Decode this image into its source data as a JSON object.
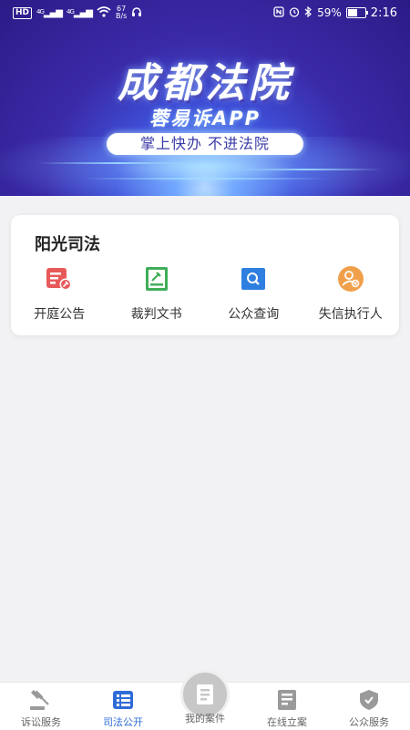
{
  "status_bar": {
    "network": "HD",
    "net_speed_value": "67",
    "net_speed_unit": "B/s",
    "signal_1": "4G",
    "signal_2": "4G",
    "battery_percent": "59%",
    "battery_level": 0.59,
    "time": "2:16"
  },
  "banner": {
    "title": "成都法院",
    "subtitle": "蓉易诉APP",
    "slogan": "掌上快办  不进法院"
  },
  "section": {
    "title": "阳光司法",
    "items": [
      {
        "label": "开庭公告",
        "icon": "court-notice-icon",
        "color": "#e8595a"
      },
      {
        "label": "裁判文书",
        "icon": "judgment-document-icon",
        "color": "#3fae5a"
      },
      {
        "label": "公众查询",
        "icon": "public-search-icon",
        "color": "#2f7fe0"
      },
      {
        "label": "失信执行人",
        "icon": "dishonest-executee-icon",
        "color": "#f0a04b"
      }
    ]
  },
  "tabbar": {
    "tabs": [
      {
        "label": "诉讼服务",
        "icon": "gavel-icon"
      },
      {
        "label": "司法公开",
        "icon": "list-icon"
      },
      {
        "label": "我的案件",
        "icon": "case-book-icon"
      },
      {
        "label": "在线立案",
        "icon": "online-filing-icon"
      },
      {
        "label": "公众服务",
        "icon": "shield-icon"
      }
    ],
    "active_index": 1,
    "colors": {
      "active": "#2f6cd8",
      "inactive": "#9a9a9a"
    }
  }
}
